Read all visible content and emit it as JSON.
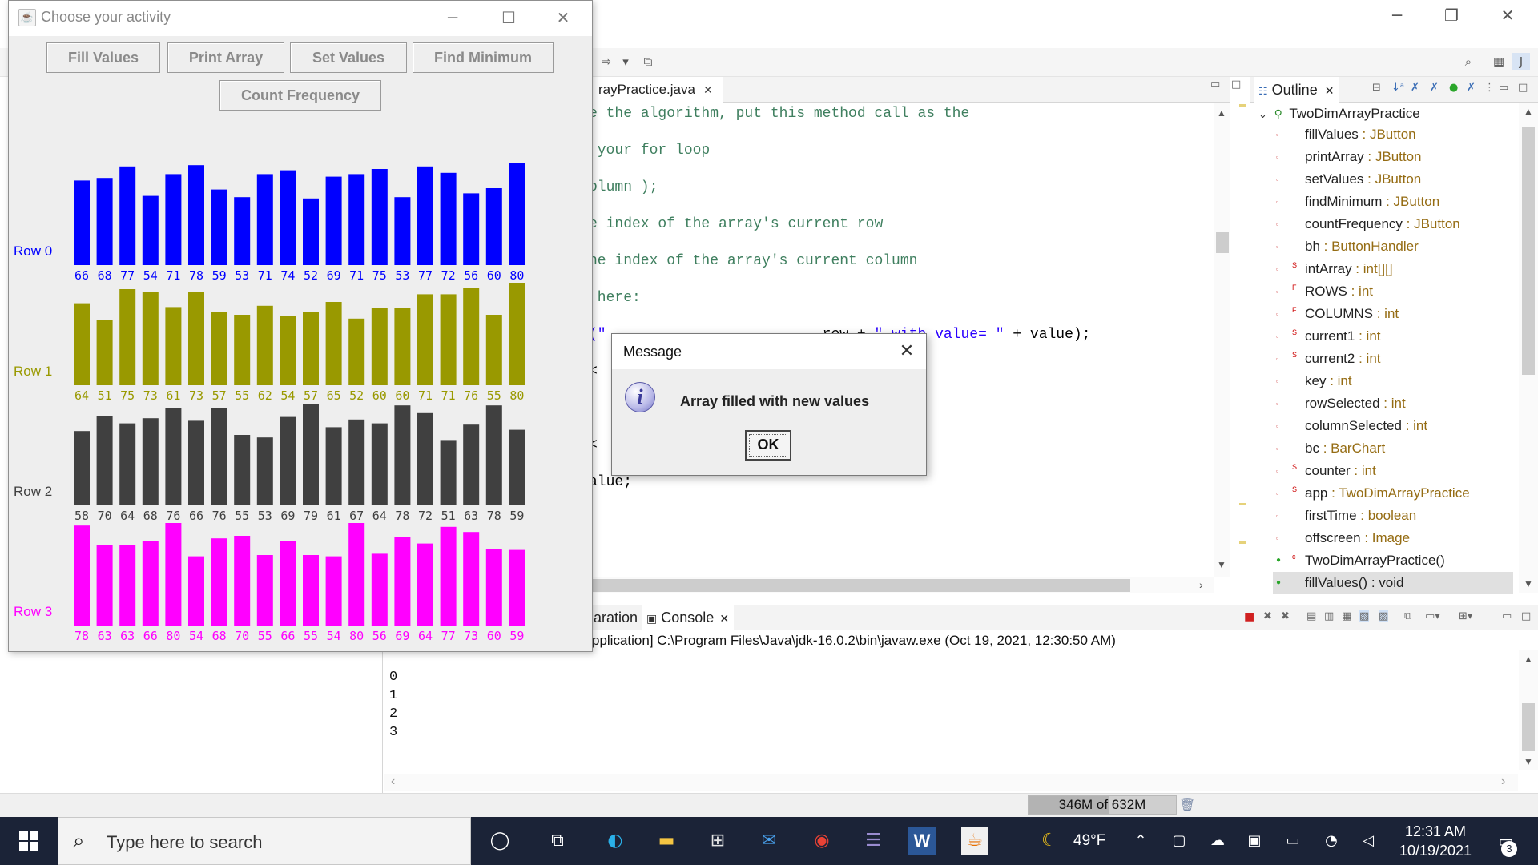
{
  "eclipse": {
    "editor_tab": "rayPractice.java",
    "code_lines": [
      {
        "top": 4,
        "tokens": [
          {
            "t": "e the algorithm, put this method call as the",
            "c": "tok-comment"
          }
        ]
      },
      {
        "top": 50,
        "tokens": [
          {
            "t": " your for loop",
            "c": "tok-comment"
          }
        ]
      },
      {
        "top": 96,
        "tokens": [
          {
            "t": "olumn );",
            "c": "tok-comment"
          }
        ]
      },
      {
        "top": 142,
        "tokens": [
          {
            "t": "e index of the array's current row",
            "c": "tok-comment"
          }
        ]
      },
      {
        "top": 188,
        "tokens": [
          {
            "t": "he index of the array's current column",
            "c": "tok-comment"
          }
        ]
      },
      {
        "top": 234,
        "tokens": [
          {
            "t": " here:",
            "c": "tok-comment"
          }
        ]
      },
      {
        "top": 280,
        "tokens": [
          {
            "t": "(\"",
            "c": "tok-string"
          },
          {
            "t": "                         row + ",
            "c": "tok-plain"
          },
          {
            "t": "\" with value= \"",
            "c": "tok-string"
          },
          {
            "t": " + value);",
            "c": "tok-plain"
          }
        ]
      },
      {
        "top": 326,
        "tokens": [
          {
            "t": "<",
            "c": "tok-plain"
          }
        ]
      },
      {
        "top": 418,
        "tokens": [
          {
            "t": "<",
            "c": "tok-plain"
          }
        ]
      },
      {
        "top": 464,
        "tokens": [
          {
            "t": "alue;",
            "c": "tok-plain"
          }
        ]
      }
    ],
    "outline": {
      "tab": "Outline",
      "root": "TwoDimArrayPractice",
      "items": [
        {
          "name": "fillValues",
          "type": " : JButton",
          "mark": ""
        },
        {
          "name": "printArray",
          "type": " : JButton",
          "mark": ""
        },
        {
          "name": "setValues",
          "type": " : JButton",
          "mark": ""
        },
        {
          "name": "findMinimum",
          "type": " : JButton",
          "mark": ""
        },
        {
          "name": "countFrequency",
          "type": " : JButton",
          "mark": ""
        },
        {
          "name": "bh",
          "type": " : ButtonHandler",
          "mark": ""
        },
        {
          "name": "intArray",
          "type": " : int[][]",
          "mark": "S"
        },
        {
          "name": "ROWS",
          "type": " : int",
          "mark": "F"
        },
        {
          "name": "COLUMNS",
          "type": " : int",
          "mark": "F"
        },
        {
          "name": "current1",
          "type": " : int",
          "mark": "S"
        },
        {
          "name": "current2",
          "type": " : int",
          "mark": "S"
        },
        {
          "name": "key",
          "type": " : int",
          "mark": ""
        },
        {
          "name": "rowSelected",
          "type": " : int",
          "mark": ""
        },
        {
          "name": "columnSelected",
          "type": " : int",
          "mark": ""
        },
        {
          "name": "bc",
          "type": " : BarChart",
          "mark": ""
        },
        {
          "name": "counter",
          "type": " : int",
          "mark": "S"
        },
        {
          "name": "app",
          "type": " : TwoDimArrayPractice",
          "mark": "S"
        },
        {
          "name": "firstTime",
          "type": " : boolean",
          "mark": ""
        },
        {
          "name": "offscreen",
          "type": " : Image",
          "mark": ""
        },
        {
          "name": "TwoDimArrayPractice()",
          "type": "",
          "mark": "c"
        },
        {
          "name": "fillValues() : void",
          "type": "",
          "mark": ""
        }
      ]
    },
    "console": {
      "tab_partial": "aration",
      "tab": "Console",
      "header": "pplication] C:\\Program Files\\Java\\jdk-16.0.2\\bin\\javaw.exe  (Oct 19, 2021, 12:30:50 AM)",
      "lines": [
        "0",
        "1",
        "2",
        "3"
      ]
    },
    "heap": "346M of 632M"
  },
  "swing": {
    "title": "Choose your activity",
    "buttons": [
      "Fill Values",
      "Print Array",
      "Set Values",
      "Find Minimum",
      "Count Frequency"
    ]
  },
  "chart_data": {
    "type": "bar",
    "title": "",
    "series": [
      {
        "name": "Row 0",
        "color": "#0000ff",
        "values": [
          66,
          68,
          77,
          54,
          71,
          78,
          59,
          53,
          71,
          74,
          52,
          69,
          71,
          75,
          53,
          77,
          72,
          56,
          60,
          80
        ]
      },
      {
        "name": "Row 1",
        "color": "#999900",
        "values": [
          64,
          51,
          75,
          73,
          61,
          73,
          57,
          55,
          62,
          54,
          57,
          65,
          52,
          60,
          60,
          71,
          71,
          76,
          55,
          80
        ]
      },
      {
        "name": "Row 2",
        "color": "#404040",
        "values": [
          58,
          70,
          64,
          68,
          76,
          66,
          76,
          55,
          53,
          69,
          79,
          61,
          67,
          64,
          78,
          72,
          51,
          63,
          78,
          59
        ]
      },
      {
        "name": "Row 3",
        "color": "#ff00ff",
        "values": [
          78,
          63,
          63,
          66,
          80,
          54,
          68,
          70,
          55,
          66,
          55,
          54,
          80,
          56,
          69,
          64,
          77,
          73,
          60,
          59
        ]
      }
    ]
  },
  "dialog": {
    "title": "Message",
    "message": "Array filled with new values",
    "ok": "OK"
  },
  "taskbar": {
    "search_placeholder": "Type here to search",
    "weather": "49°F",
    "time": "12:31 AM",
    "date": "10/19/2021",
    "notifications": "3"
  }
}
